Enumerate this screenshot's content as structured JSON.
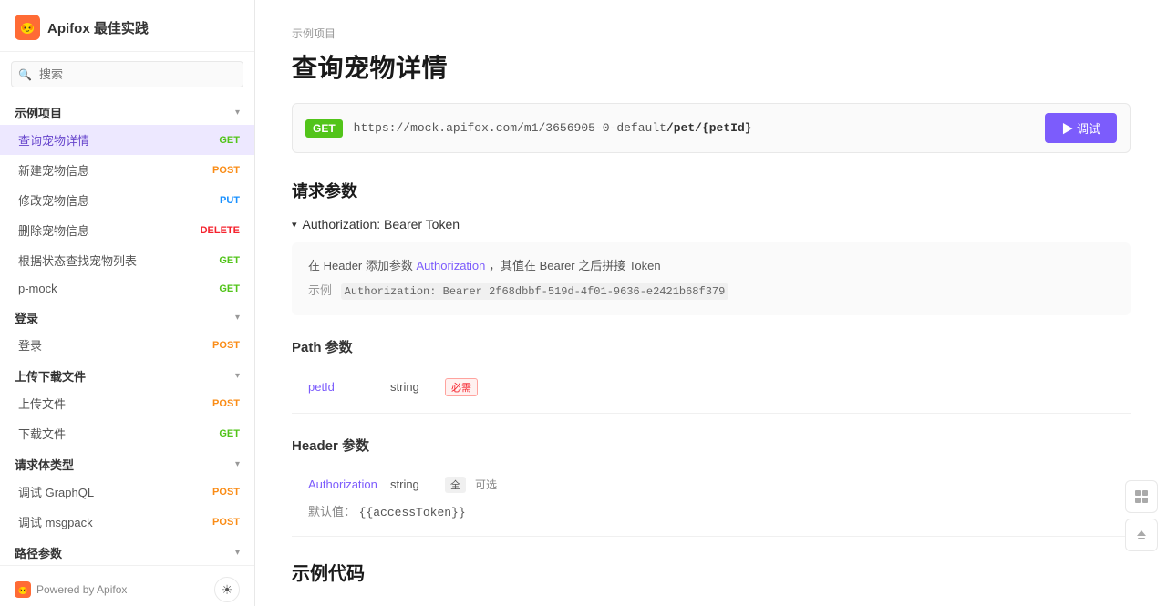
{
  "sidebar": {
    "title": "Apifox 最佳实践",
    "search_placeholder": "搜索",
    "groups": [
      {
        "label": "示例项目",
        "items": [
          {
            "name": "查询宠物详情",
            "method": "GET",
            "active": true
          },
          {
            "name": "新建宠物信息",
            "method": "POST"
          },
          {
            "name": "修改宠物信息",
            "method": "PUT"
          },
          {
            "name": "删除宠物信息",
            "method": "DELETE"
          },
          {
            "name": "根据状态查找宠物列表",
            "method": "GET"
          },
          {
            "name": "p-mock",
            "method": "GET",
            "dot": true
          }
        ]
      },
      {
        "label": "登录",
        "items": [
          {
            "name": "登录",
            "method": "POST",
            "dot": true
          }
        ]
      },
      {
        "label": "上传下载文件",
        "items": [
          {
            "name": "上传文件",
            "method": "POST",
            "dot": true
          },
          {
            "name": "下载文件",
            "method": "GET",
            "dot": true
          }
        ]
      },
      {
        "label": "请求体类型",
        "items": [
          {
            "name": "调试 GraphQL",
            "method": "POST",
            "dot": true
          },
          {
            "name": "调试 msgpack",
            "method": "POST",
            "dot": true
          }
        ]
      },
      {
        "label": "路径参数",
        "items": []
      }
    ],
    "footer": {
      "powered_by": "Powered by Apifox"
    }
  },
  "main": {
    "breadcrumb": "示例项目",
    "page_title": "查询宠物详情",
    "endpoint": {
      "method": "GET",
      "url_prefix": "https://mock.apifox.com/m1/3656905-0-default",
      "url_path": "/pet/{petId}",
      "try_label": "▶ 调试"
    },
    "request_params_title": "请求参数",
    "auth_section": {
      "header": "Authorization: Bearer Token",
      "description_prefix": "在 Header 添加参数",
      "auth_link": "Authorization",
      "description_mid": "，其值在 Bearer 之后拼接 Token",
      "example_label": "示例",
      "example_value": "Authorization: Bearer 2f68dbbf-519d-4f01-9636-e2421b68f379"
    },
    "path_params": {
      "title": "Path 参数",
      "params": [
        {
          "name": "petId",
          "type": "string",
          "required": true,
          "required_label": "必需"
        }
      ]
    },
    "header_params": {
      "title": "Header 参数",
      "params": [
        {
          "name": "Authorization",
          "type": "string",
          "badge_all": "全",
          "optional_label": "可选",
          "default_label": "默认值：",
          "default_value": "{{accessToken}}"
        }
      ]
    },
    "example_code_title": "示例代码"
  },
  "float_panel": {
    "grid_icon": "⊞",
    "top_icon": "↑"
  }
}
